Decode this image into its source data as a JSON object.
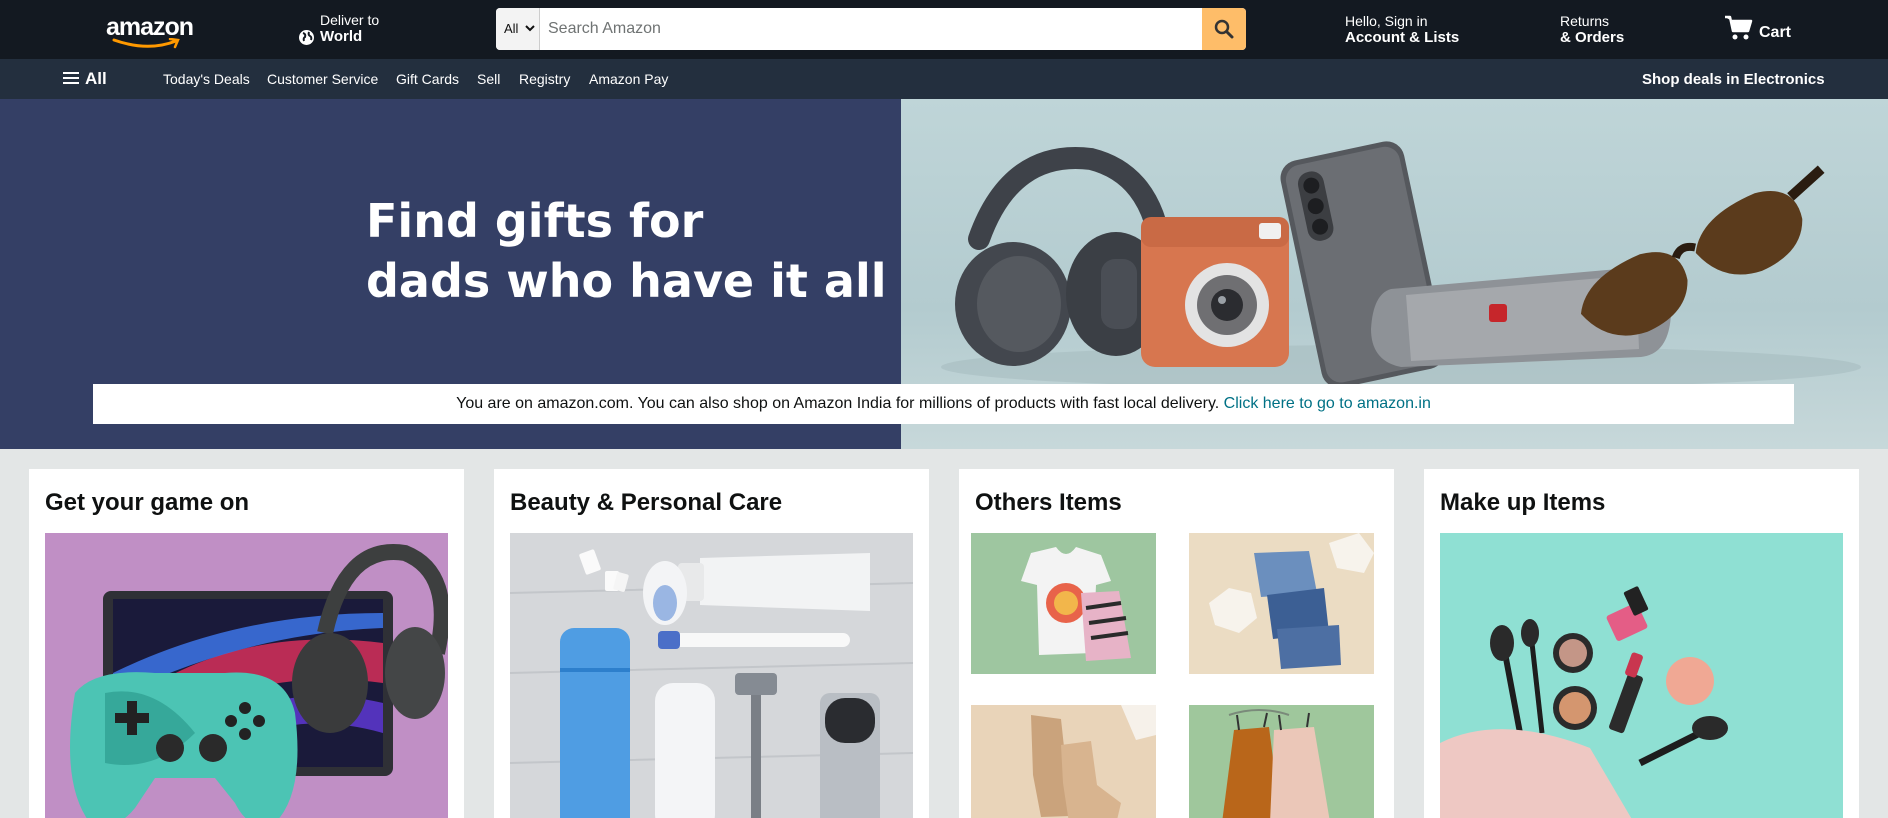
{
  "header": {
    "logo_text": "amazon",
    "deliver_label": "Deliver to",
    "deliver_location": "World",
    "search": {
      "category": "All",
      "placeholder": "Search Amazon"
    },
    "account": {
      "greeting": "Hello, Sign in",
      "label": "Account & Lists"
    },
    "orders": {
      "line1": "Returns",
      "line2": "& Orders"
    },
    "cart_label": "Cart",
    "colors": {
      "bg": "#131921",
      "search_button": "#febd69"
    }
  },
  "subnav": {
    "all_label": "All",
    "links": [
      "Today's Deals",
      "Customer Service",
      "Gift Cards",
      "Sell",
      "Registry",
      "Amazon Pay"
    ],
    "promo": "Shop deals in Electronics",
    "bg": "#232f3e"
  },
  "hero": {
    "title_line1": "Find gifts for",
    "title_line2": "dads who have it all",
    "left_bg": "#343f65"
  },
  "notice": {
    "text": "You are on amazon.com. You can also shop on Amazon India for millions of products with fast local delivery. ",
    "link": "Click here to go to amazon.in",
    "link_color": "#007185"
  },
  "cards": [
    {
      "title": "Get your game on",
      "image": "gaming-laptop-controller-headset"
    },
    {
      "title": "Beauty & Personal Care",
      "image": "personal-care-products"
    },
    {
      "title": "Others Items",
      "tiles": [
        "graphic-tee-and-tank",
        "folded-jeans",
        "ankle-boots",
        "silk-camisoles"
      ]
    },
    {
      "title": "Make up Items",
      "image": "makeup-brushes-and-cosmetics"
    }
  ]
}
